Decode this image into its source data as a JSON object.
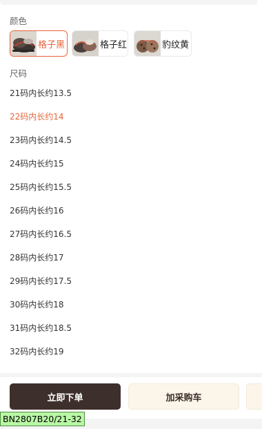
{
  "color_section": {
    "title": "颜色",
    "options": [
      {
        "label": "格子黑",
        "selected": true
      },
      {
        "label": "格子红",
        "selected": false
      },
      {
        "label": "豹纹黄",
        "selected": false
      }
    ]
  },
  "size_section": {
    "title": "尺码",
    "options": [
      {
        "label": "21码内长约13.5",
        "selected": false
      },
      {
        "label": "22码内长约14",
        "selected": true
      },
      {
        "label": "23码内长约14.5",
        "selected": false
      },
      {
        "label": "24码内长约15",
        "selected": false
      },
      {
        "label": "25码内长约15.5",
        "selected": false
      },
      {
        "label": "26码内长约16",
        "selected": false
      },
      {
        "label": "27码内长约16.5",
        "selected": false
      },
      {
        "label": "28码内长约17",
        "selected": false
      },
      {
        "label": "29码内长约17.5",
        "selected": false
      },
      {
        "label": "30码内长约18",
        "selected": false
      },
      {
        "label": "31码内长约18.5",
        "selected": false
      },
      {
        "label": "32码内长约19",
        "selected": false
      }
    ]
  },
  "actions": {
    "buy_now": "立即下单",
    "add_to_cart": "加采购车"
  },
  "sku_tag": "BN2807B20/21-32",
  "colors": {
    "accent": "#e8643a",
    "buy_button": "#3d2f2b",
    "cart_button": "#fbf5ea",
    "sku_tag": "#b9f7a6"
  }
}
